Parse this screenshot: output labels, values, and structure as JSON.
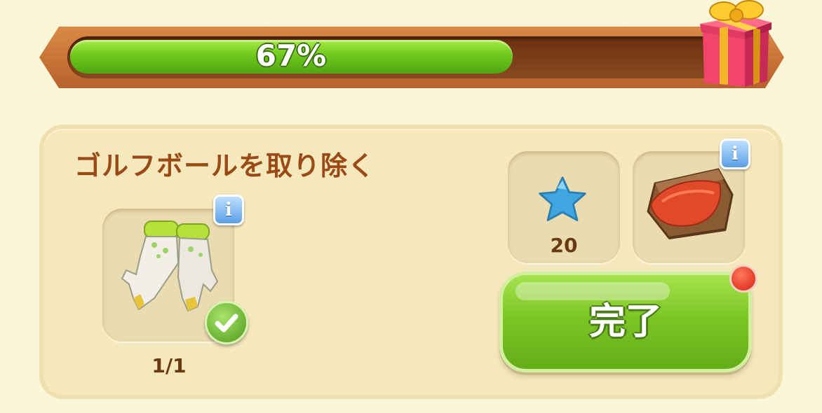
{
  "progress": {
    "percent": 67,
    "label": "67%",
    "reward_icon": "gift-box-icon"
  },
  "quest": {
    "title": "ゴルフボールを取り除く",
    "requirement": {
      "icon": "garden-gloves-icon",
      "count_label": "1/1",
      "completed": true,
      "info_icon": "info-icon",
      "check_icon": "checkmark-icon"
    },
    "rewards": [
      {
        "icon": "blue-star-icon",
        "amount_label": "20"
      },
      {
        "icon": "wooden-crate-icon",
        "info_icon": "info-icon"
      }
    ],
    "complete_button": {
      "label": "完了",
      "has_notification": true
    }
  },
  "colors": {
    "background": "#fbf6d8",
    "accent_green": "#7cc526",
    "title_brown": "#9a4a14",
    "frame_orange": "#c8743a"
  }
}
